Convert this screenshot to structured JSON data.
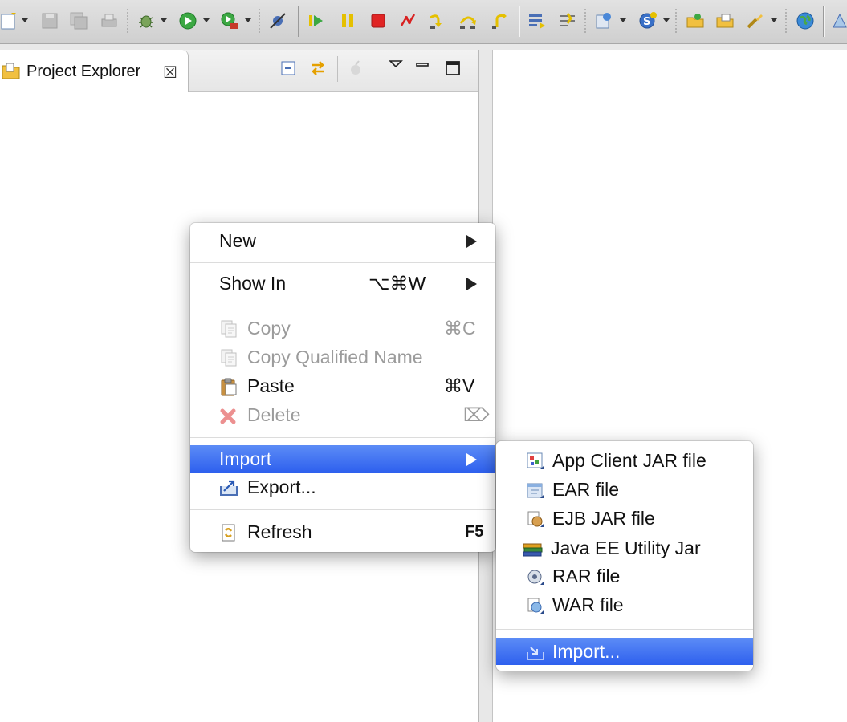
{
  "view": {
    "title": "Project Explorer",
    "close_glyph": "☒"
  },
  "toolbar": {
    "icons": [
      "new-wizard-icon",
      "save-icon",
      "save-all-icon",
      "print-icon",
      "debug-icon",
      "run-icon",
      "external-tools-icon",
      "skip-breakpoints-icon",
      "resume-icon",
      "suspend-icon",
      "terminate-icon",
      "disconnect-icon",
      "step-into-icon",
      "step-over-icon",
      "step-return-icon",
      "toggle-mark-occurrences-icon",
      "use-step-filters-icon",
      "new-server-icon",
      "new-spring-icon",
      "open-type-icon",
      "open-task-icon",
      "search-icon",
      "globe-icon"
    ]
  },
  "context_menu": {
    "items": [
      {
        "label": "New",
        "shortcut": "",
        "submenu": true
      },
      {
        "label": "Show In",
        "shortcut": "⌥⌘W",
        "submenu": true
      },
      {
        "label": "Copy",
        "shortcut": "⌘C",
        "disabled": true,
        "icon": "copy-icon"
      },
      {
        "label": "Copy Qualified Name",
        "shortcut": "",
        "disabled": true,
        "icon": "copy-qualified-name-icon"
      },
      {
        "label": "Paste",
        "shortcut": "⌘V",
        "icon": "paste-icon"
      },
      {
        "label": "Delete",
        "shortcut": "⌦",
        "disabled": true,
        "icon": "delete-icon"
      },
      {
        "label": "Import",
        "shortcut": "",
        "submenu": true,
        "selected": true
      },
      {
        "label": "Export...",
        "shortcut": "",
        "icon": "export-icon"
      },
      {
        "label": "Refresh",
        "shortcut": "F5",
        "icon": "refresh-icon"
      }
    ]
  },
  "import_submenu": {
    "items": [
      {
        "label": "App Client JAR file",
        "icon": "app-client-jar-icon"
      },
      {
        "label": "EAR file",
        "icon": "ear-file-icon"
      },
      {
        "label": "EJB JAR file",
        "icon": "ejb-jar-icon"
      },
      {
        "label": "Java EE Utility Jar",
        "icon": "java-ee-utility-jar-icon"
      },
      {
        "label": "RAR file",
        "icon": "rar-file-icon"
      },
      {
        "label": "WAR file",
        "icon": "war-file-icon"
      },
      {
        "label": "Import...",
        "icon": "import-wizard-icon",
        "selected": true
      }
    ]
  },
  "colors": {
    "selection": "#3d6ff0",
    "disabled_text": "#9b9b9b"
  }
}
